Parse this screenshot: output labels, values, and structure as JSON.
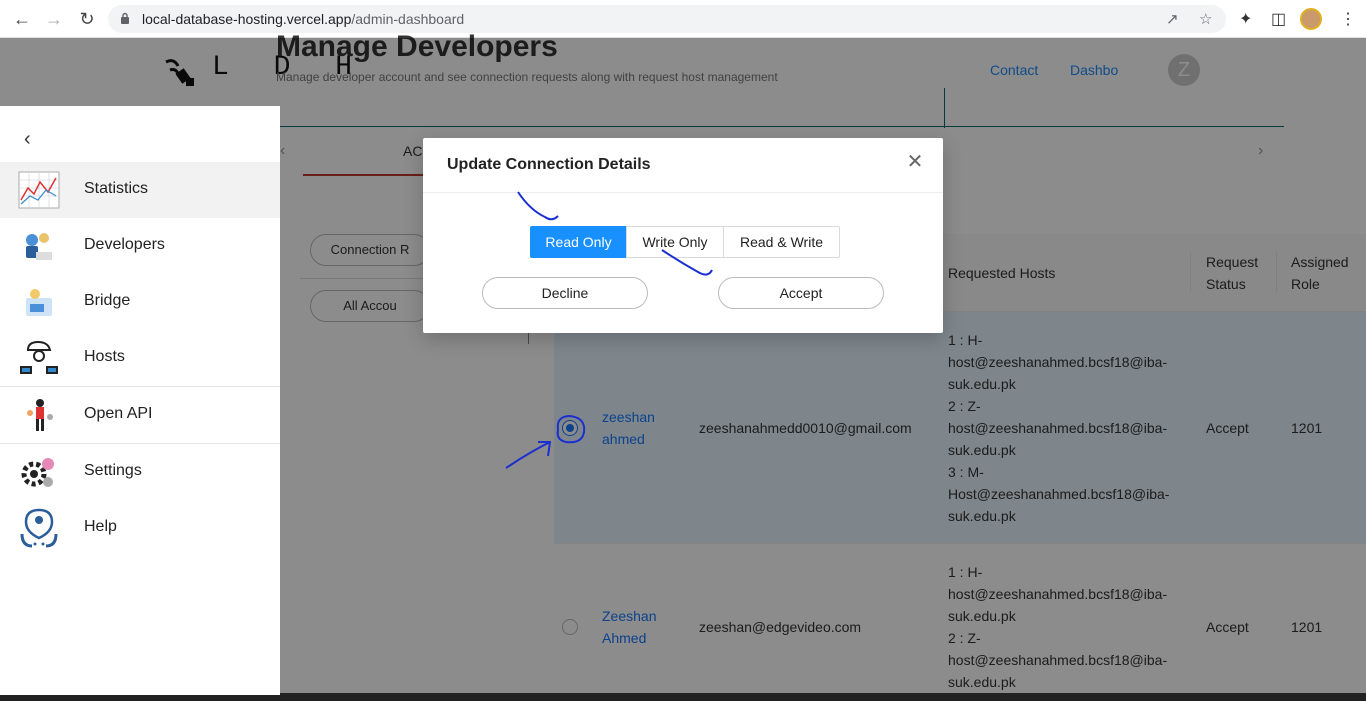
{
  "browser": {
    "url_host": "local-database-hosting.vercel.app",
    "url_path": "/admin-dashboard",
    "icons": [
      "back-icon",
      "forward-icon",
      "reload-icon",
      "lock-icon",
      "share-icon",
      "star-icon",
      "extensions-icon",
      "sidepanel-icon",
      "profile-avatar",
      "menu-icon"
    ]
  },
  "header": {
    "logo_text": "L D H",
    "page_title": "Manage Developers",
    "page_subtitle": "Manage developer account and see connection requests along with request host management",
    "link_contact": "Contact",
    "link_dashboard": "Dashbo",
    "avatar_letter": "Z"
  },
  "tabs": {
    "active_label": "AC"
  },
  "filters": {
    "pill1": "Connection R",
    "pill2": "All Accou"
  },
  "sidebar": {
    "items": [
      {
        "label": "Statistics",
        "icon": "statistics-icon"
      },
      {
        "label": "Developers",
        "icon": "developers-icon"
      },
      {
        "label": "Bridge",
        "icon": "bridge-icon"
      },
      {
        "label": "Hosts",
        "icon": "hosts-icon"
      },
      {
        "label": "Open API",
        "icon": "open-api-icon"
      },
      {
        "label": "Settings",
        "icon": "settings-icon"
      },
      {
        "label": "Help",
        "icon": "help-icon"
      }
    ]
  },
  "table": {
    "headers": {
      "hosts": "Requested Hosts",
      "status_1": "Request",
      "status_2": "Status",
      "role_1": "Assigned",
      "role_2": "Role"
    },
    "rows": [
      {
        "name_1": "zeeshan",
        "name_2": "ahmed",
        "email": "zeeshanahmedd0010@gmail.com",
        "hosts": [
          "1 : H-",
          "host@zeeshanahmed.bcsf18@iba-",
          "suk.edu.pk",
          "2 : Z-",
          "host@zeeshanahmed.bcsf18@iba-",
          "suk.edu.pk",
          "3 : M-",
          "Host@zeeshanahmed.bcsf18@iba-",
          "suk.edu.pk"
        ],
        "status": "Accept",
        "role": "1201",
        "selected": true
      },
      {
        "name_1": "Zeeshan",
        "name_2": "Ahmed",
        "email": "zeeshan@edgevideo.com",
        "hosts": [
          "1 : H-",
          "host@zeeshanahmed.bcsf18@iba-",
          "suk.edu.pk",
          "2 : Z-",
          "host@zeeshanahmed.bcsf18@iba-",
          "suk.edu.pk"
        ],
        "status": "Accept",
        "role": "1201",
        "selected": false
      }
    ]
  },
  "modal": {
    "title": "Update Connection Details",
    "options": [
      "Read Only",
      "Write Only",
      "Read & Write"
    ],
    "selected_option": "Read Only",
    "decline_label": "Decline",
    "accept_label": "Accept"
  },
  "colors": {
    "primary": "#1890ff",
    "link": "#1677ff",
    "selected_row": "#e6f4ff",
    "annotation_ink": "#1a2fd0"
  }
}
